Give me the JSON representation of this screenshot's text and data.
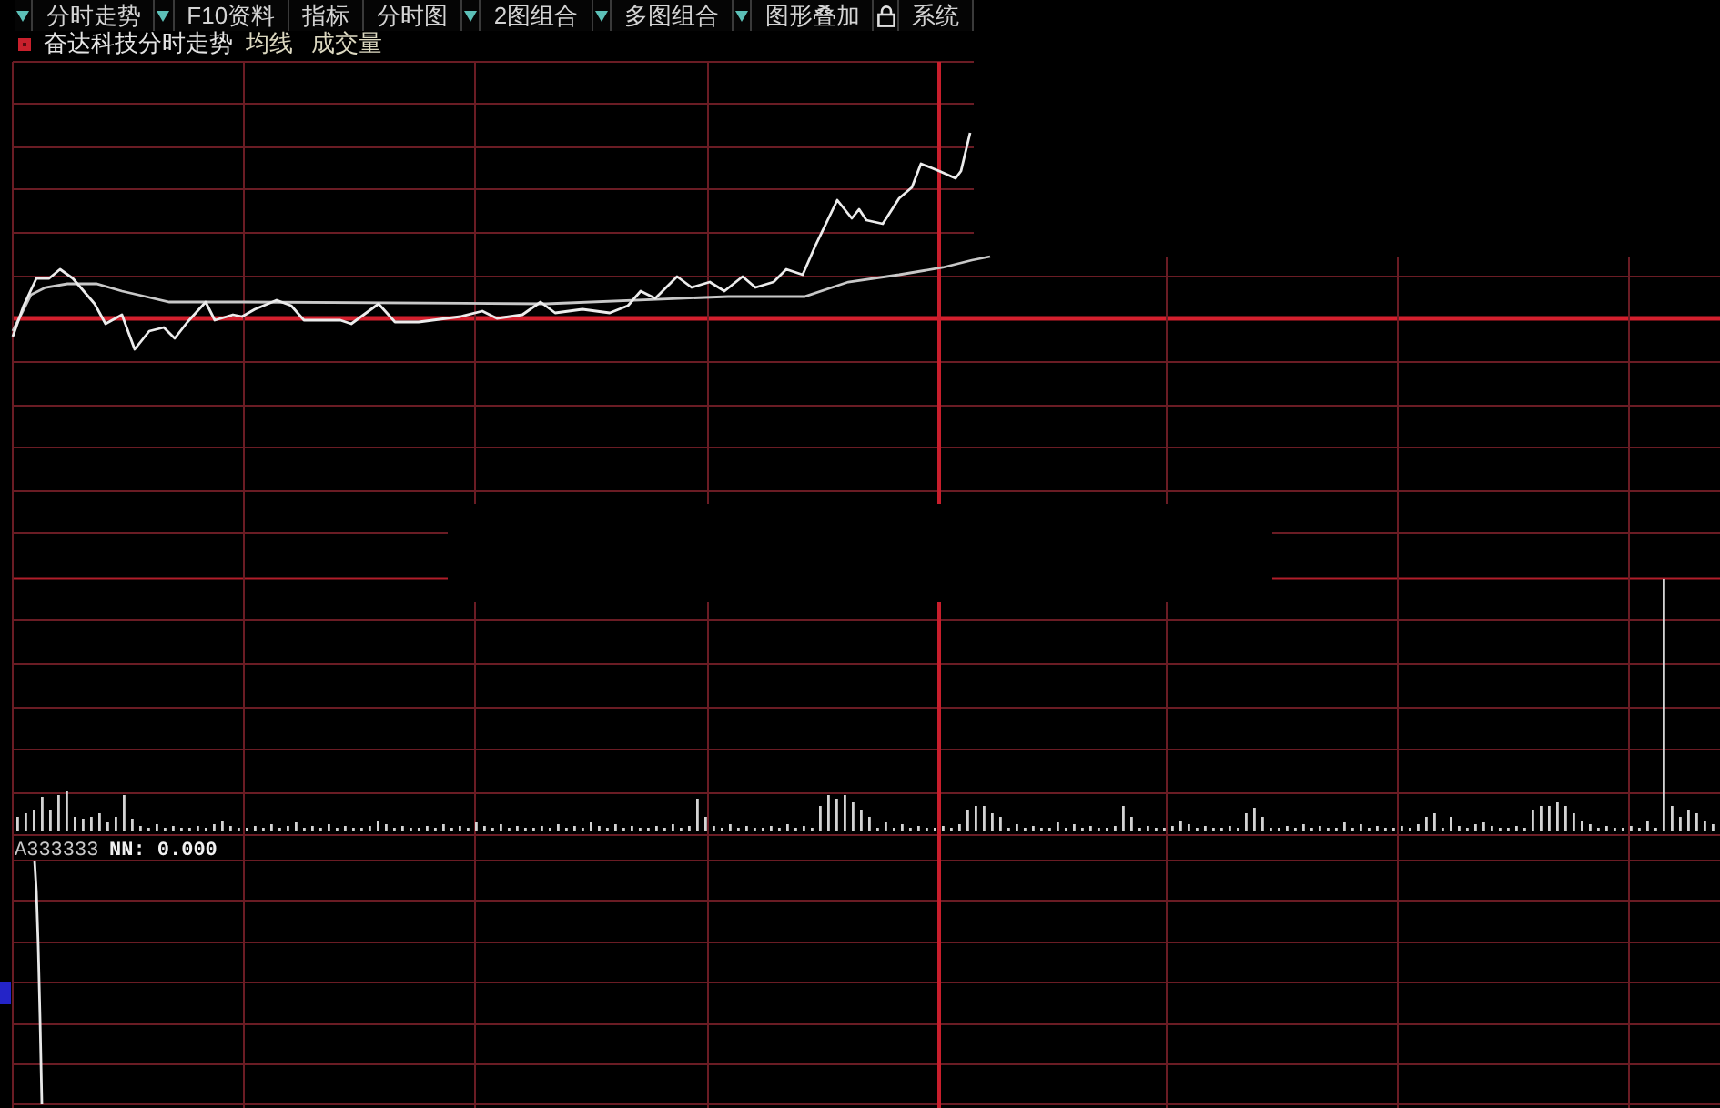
{
  "toolbar": {
    "items": [
      {
        "kind": "dropdown"
      },
      {
        "kind": "button",
        "label": "分时走势"
      },
      {
        "kind": "dropdown"
      },
      {
        "kind": "button",
        "label": "F10资料"
      },
      {
        "kind": "button",
        "label": "指标"
      },
      {
        "kind": "button",
        "label": "分时图"
      },
      {
        "kind": "dropdown"
      },
      {
        "kind": "button",
        "label": "2图组合"
      },
      {
        "kind": "dropdown"
      },
      {
        "kind": "button",
        "label": "多图组合"
      },
      {
        "kind": "dropdown"
      },
      {
        "kind": "button",
        "label": "图形叠加"
      },
      {
        "kind": "lock"
      },
      {
        "kind": "button",
        "label": "系统"
      }
    ]
  },
  "chart_header": {
    "title": "奋达科技分时走势",
    "legend": [
      "均线",
      "成交量"
    ]
  },
  "indicator": {
    "name": "A333333",
    "reading": "NN: 0.000"
  }
}
